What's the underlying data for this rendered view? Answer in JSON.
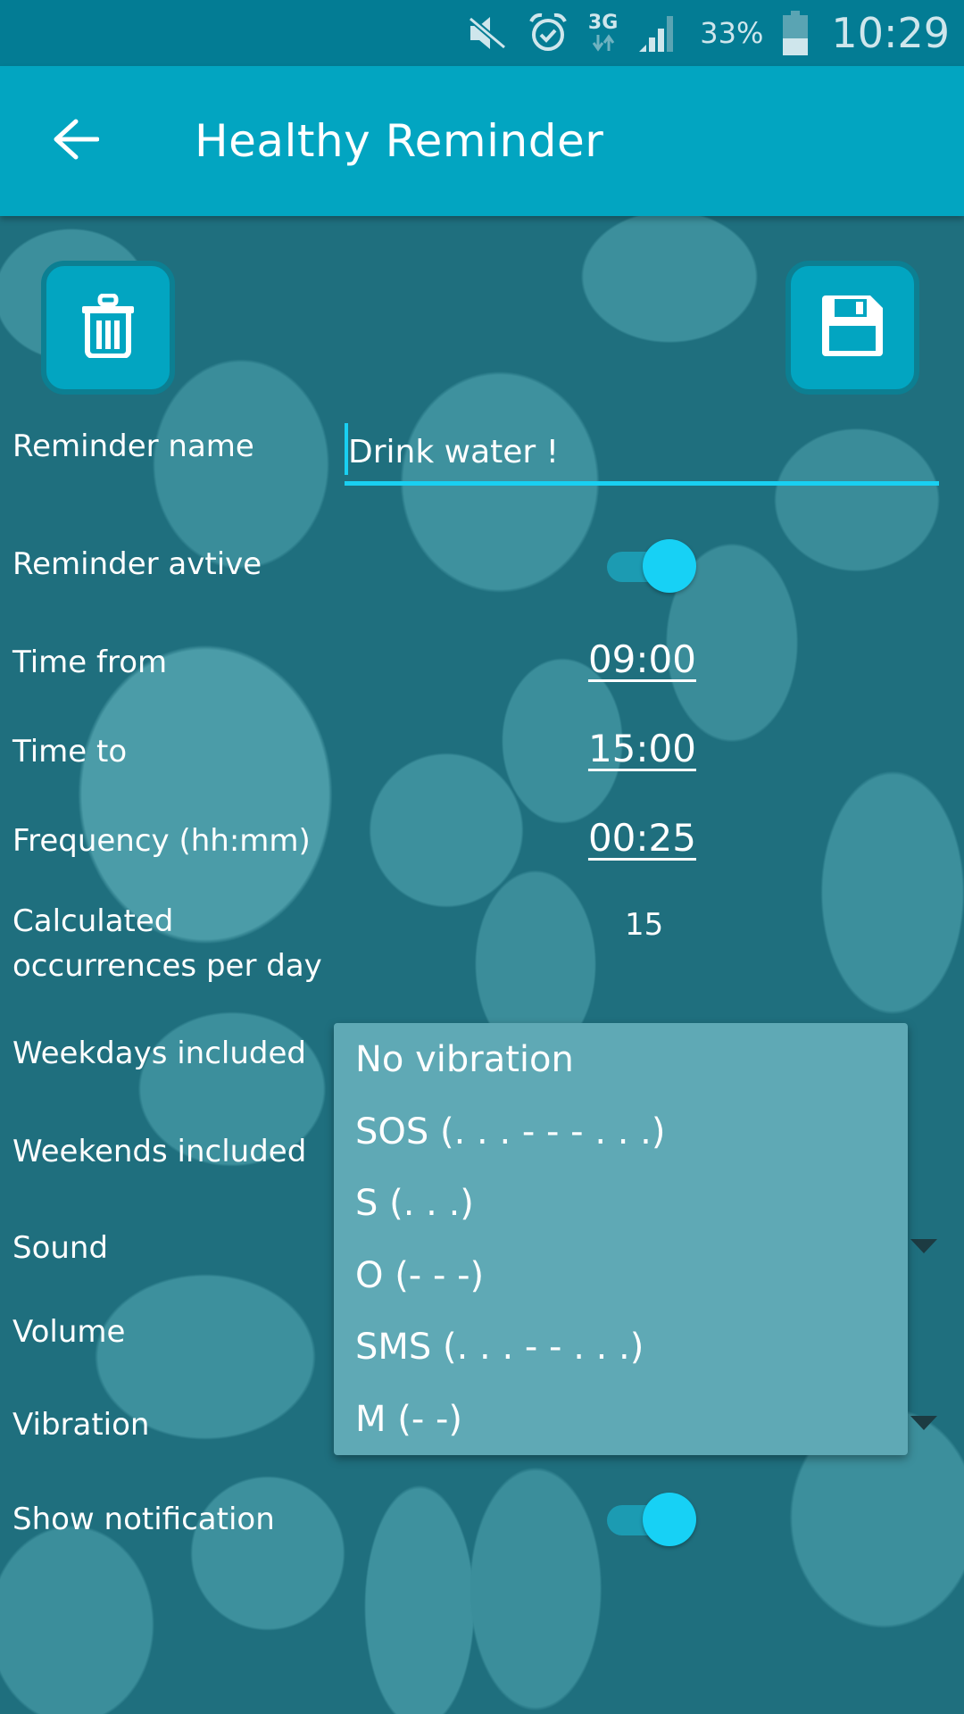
{
  "status_bar": {
    "icons": [
      "mute-icon",
      "alarm-icon",
      "network-3g-icon",
      "signal-icon",
      "battery-icon"
    ],
    "network_type": "3G",
    "battery_percent": "33%",
    "battery_level": 0.33,
    "time": "10:29"
  },
  "app_bar": {
    "title": "Healthy Reminder",
    "back_icon": "arrow-left-icon"
  },
  "actions": {
    "delete_icon": "trash-icon",
    "save_icon": "floppy-disk-icon"
  },
  "colors": {
    "primary": "#02a5c1",
    "status_bar": "#037c94",
    "accent": "#19d0f2",
    "popup_bg": "#5fa9b5"
  },
  "form": {
    "reminder_name": {
      "label": "Reminder name",
      "value": "Drink water !"
    },
    "reminder_active": {
      "label": "Reminder avtive",
      "checked": true
    },
    "time_from": {
      "label": "Time from",
      "value": "09:00"
    },
    "time_to": {
      "label": "Time to",
      "value": "15:00"
    },
    "frequency": {
      "label": "Frequency (hh:mm)",
      "value": "00:25"
    },
    "occurrences": {
      "label_line1": "Calculated",
      "label_line2": "occurrences per day",
      "value": "15"
    },
    "weekdays": {
      "label": "Weekdays included"
    },
    "weekends": {
      "label": "Weekends included"
    },
    "sound": {
      "label": "Sound"
    },
    "volume": {
      "label": "Volume"
    },
    "vibration": {
      "label": "Vibration"
    },
    "show_notification": {
      "label": "Show notification",
      "checked": true
    }
  },
  "vibration_dropdown": {
    "options": [
      "No vibration",
      "SOS (. . . - - - . . .)",
      "S (. . .)",
      "O (- - -)",
      "SMS (. . . - - . . .)",
      "M (- -)"
    ]
  }
}
